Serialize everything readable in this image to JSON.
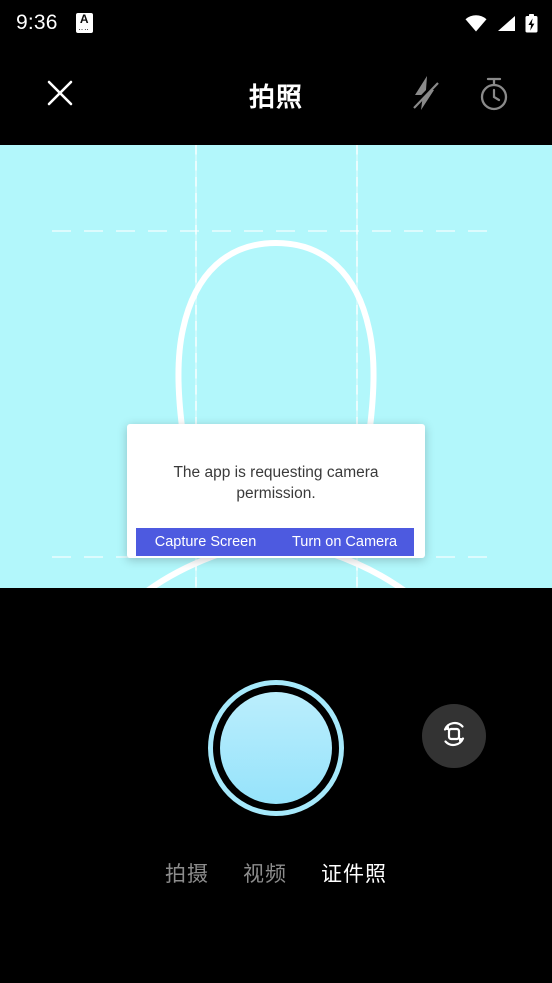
{
  "statusbar": {
    "time": "9:36",
    "app_badge_letter": "A",
    "app_badge_dots": "‥‥",
    "icons": [
      "wifi-icon",
      "cellular-signal-icon",
      "battery-charging-icon"
    ]
  },
  "header": {
    "close_icon": "close-x-icon",
    "title": "拍照",
    "flash_icon": "flash-off-icon",
    "timer_icon": "timer-stopwatch-icon"
  },
  "viewfinder": {
    "background_color": "#b2f7fb",
    "guide_outline": "portrait-head-silhouette-guide",
    "grid": "dashed-composition-grid"
  },
  "dialog": {
    "message": "The app is requesting camera permission.",
    "buttons": [
      {
        "label": "Capture Screen",
        "name": "capture-screen-button"
      },
      {
        "label": "Turn on Camera",
        "name": "turn-on-camera-button"
      }
    ],
    "button_color": "#4d5ae0",
    "background_color": "#ffffff"
  },
  "controls": {
    "shutter_icon": "shutter-button",
    "shutter_color": "#a6e9fb",
    "flip_icon": "switch-camera-icon",
    "modes": [
      {
        "label": "拍摄",
        "active": false
      },
      {
        "label": "视频",
        "active": false
      },
      {
        "label": "证件照",
        "active": true
      }
    ]
  }
}
